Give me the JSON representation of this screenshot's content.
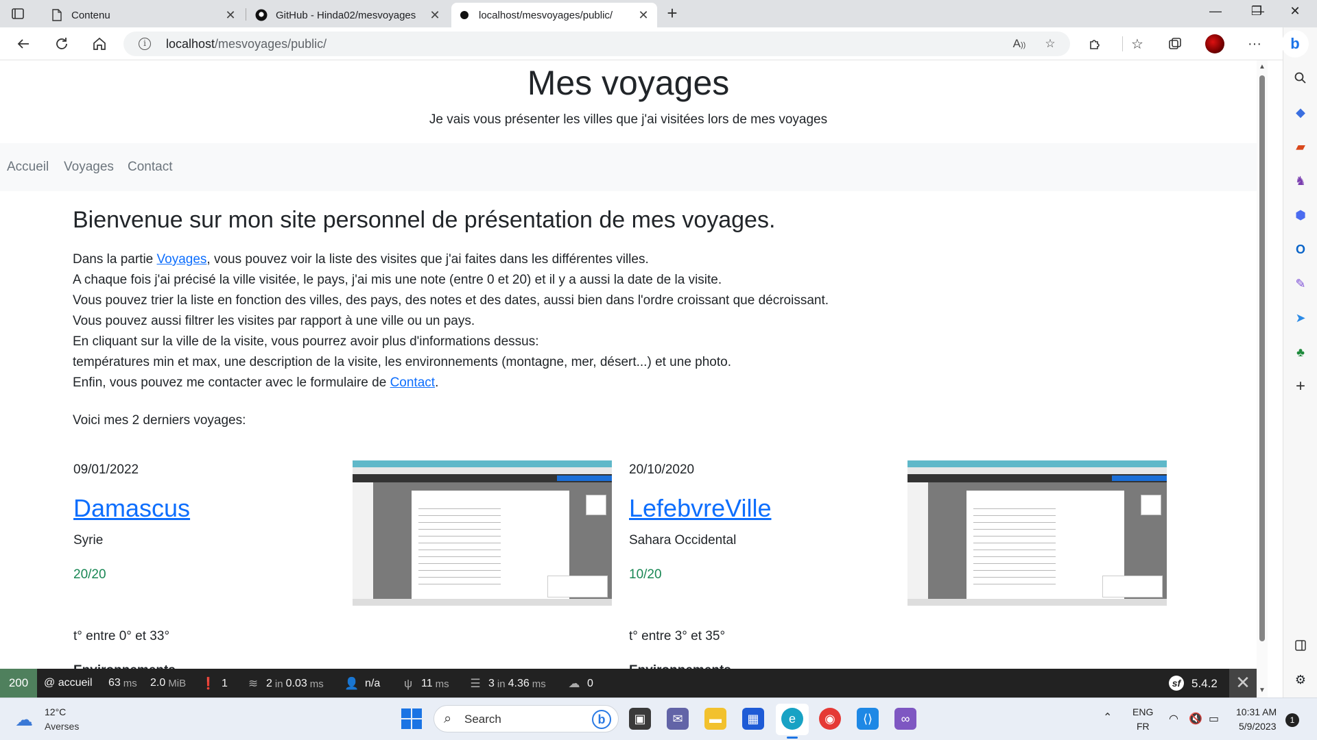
{
  "browser": {
    "tabs": [
      {
        "label": "Contenu",
        "icon": "document-icon"
      },
      {
        "label": "GitHub - Hinda02/mesvoyages",
        "icon": "github-icon"
      },
      {
        "label": "localhost/mesvoyages/public/",
        "icon": "page-dot-icon",
        "active": true
      }
    ],
    "url_host": "localhost",
    "url_path": "/mesvoyages/public/"
  },
  "site": {
    "title": "Mes voyages",
    "subtitle": "Je vais vous présenter les villes que j'ai visitées lors de mes voyages",
    "nav": [
      "Accueil",
      "Voyages",
      "Contact"
    ]
  },
  "main": {
    "heading": "Bienvenue sur mon site personnel de présentation de mes voyages.",
    "intro": {
      "l1_pre": "Dans la partie ",
      "l1_link": "Voyages",
      "l1_post": ", vous pouvez voir la liste des visites que j'ai faites dans les différentes villes.",
      "l2": "A chaque fois j'ai précisé la ville visitée, le pays, j'ai mis une note (entre 0 et 20) et il y a aussi la date de la visite.",
      "l3": "Vous pouvez trier la liste en fonction des villes, des pays, des notes et des dates, aussi bien dans l'ordre croissant que décroissant.",
      "l4": "Vous pouvez aussi filtrer les visites par rapport à une ville ou un pays.",
      "l5": "En cliquant sur la ville de la visite, vous pourrez avoir plus d'informations dessus:",
      "l6": "températures min et max, une description de la visite, les environnements (montagne, mer, désert...) et une photo.",
      "l7_pre": "Enfin, vous pouvez me contacter avec le formulaire de ",
      "l7_link": "Contact",
      "l7_post": "."
    },
    "latest_label": "Voici mes 2 derniers voyages:",
    "visits": [
      {
        "date": "09/01/2022",
        "city": "Damascus",
        "country": "Syrie",
        "note": "20/20",
        "temp": "t° entre 0° et 33°",
        "env_label": "Environnements"
      },
      {
        "date": "20/10/2020",
        "city": "LefebvreVille",
        "country": "Sahara Occidental",
        "note": "10/20",
        "temp": "t° entre 3° et 35°",
        "env_label": "Environnements"
      }
    ]
  },
  "profiler": {
    "status": "200",
    "route": "@ accueil",
    "time_value": "63",
    "time_unit": "ms",
    "memory_value": "2.0",
    "memory_unit": "MiB",
    "logs": "1",
    "forms_count": "2",
    "forms_in": "in",
    "forms_time": "0.03",
    "forms_unit": "ms",
    "user": "n/a",
    "twig_value": "11",
    "twig_unit": "ms",
    "db_count": "3",
    "db_in": "in",
    "db_time": "4.36",
    "db_unit": "ms",
    "cache": "0",
    "version": "5.4.2"
  },
  "taskbar": {
    "temperature": "12°C",
    "location": "Averses",
    "search_placeholder": "Search",
    "lang_top": "ENG",
    "lang_bottom": "FR",
    "time": "10:31 AM",
    "date": "5/9/2023",
    "notifications": "1"
  },
  "colors": {
    "link": "#0d6efd",
    "note": "#198754",
    "profiler_status": "#4f805d",
    "profiler_bg": "#222222"
  }
}
